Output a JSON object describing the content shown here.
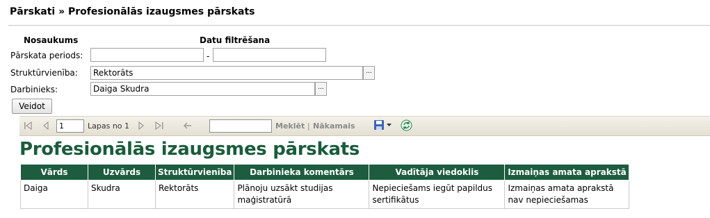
{
  "header": {
    "breadcrumb": "Pārskati » Profesionālās izaugsmes pārskats"
  },
  "form": {
    "col_name_label": "Nosaukums",
    "col_filter_label": "Datu filtrēšana",
    "period_label": "Pārskata periods:",
    "period_from": "",
    "period_separator": "-",
    "period_to": "",
    "unit_label": "Struktūrvienība:",
    "unit_value": "Rektorāts",
    "employee_label": "Darbinieks:",
    "employee_value": "Daiga Skudra",
    "browse_label": "...",
    "submit_label": "Veidot"
  },
  "toolbar": {
    "page_value": "1",
    "page_of": "Lapas no 1",
    "find_label": "Meklēt",
    "separator": "|",
    "next_label": "Nākamais",
    "search_value": ""
  },
  "report": {
    "title": "Profesionālās izaugsmes pārskats",
    "columns": [
      "Vārds",
      "Uzvārds",
      "Struktūrvienība",
      "Darbinieka komentārs",
      "Vadītāja viedoklis",
      "Izmaiņas amata aprakstā"
    ],
    "rows": [
      [
        "Daiga",
        "Skudra",
        "Rektorāts",
        "Plānoju uzsākt studijas maģistratūrā",
        "Nepieciešams iegūt papildus sertifikātus",
        "Izmaiņas amata aprakstā nav nepieciešamas"
      ]
    ],
    "header_color": "#1d5c3f"
  }
}
